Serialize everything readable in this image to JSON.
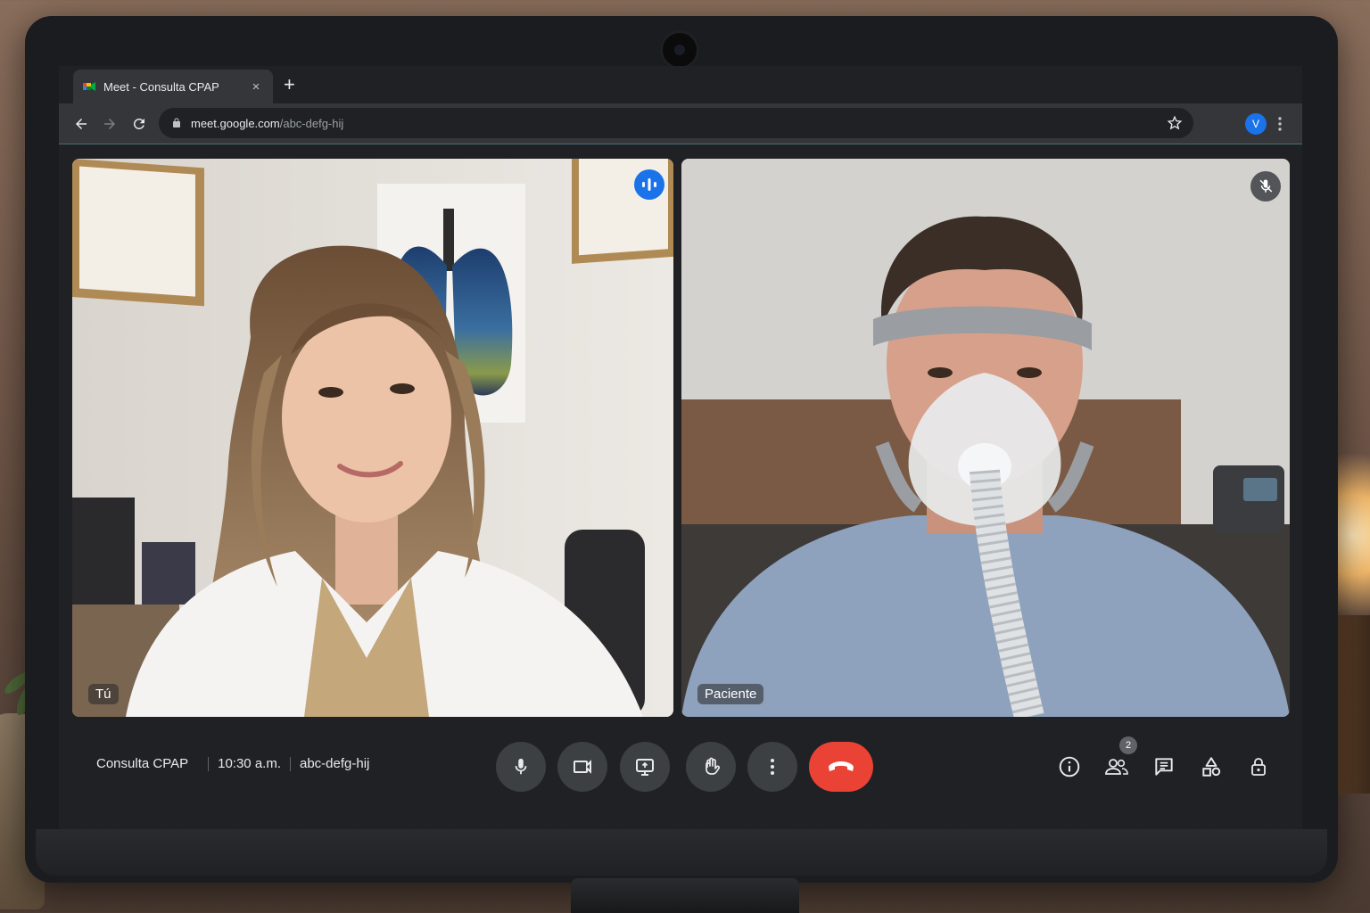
{
  "browser": {
    "tab_title": "Meet - Consulta CPAP",
    "tab_close": "×",
    "new_tab": "+",
    "url_host": "meet.google.com",
    "url_path": "/abc-defg-hij",
    "profile_initial": "V"
  },
  "participants": [
    {
      "label": "Tú",
      "state": "speaking"
    },
    {
      "label": "Paciente",
      "state": "muted"
    }
  ],
  "meeting": {
    "name": "Consulta CPAP",
    "time": "10:30 a.m.",
    "code": "abc-defg-hij",
    "participant_count": "2"
  },
  "icons": {
    "controls": [
      "mic-icon",
      "camera-icon",
      "present-screen-icon",
      "raise-hand-icon",
      "more-options-icon",
      "end-call-icon"
    ],
    "side": [
      "info-icon",
      "people-icon",
      "chat-icon",
      "activities-icon",
      "lock-icon"
    ]
  },
  "colors": {
    "accent": "#1a73e8",
    "end_call": "#ea4335",
    "control_bg": "#3c4043",
    "surface": "#202124"
  }
}
